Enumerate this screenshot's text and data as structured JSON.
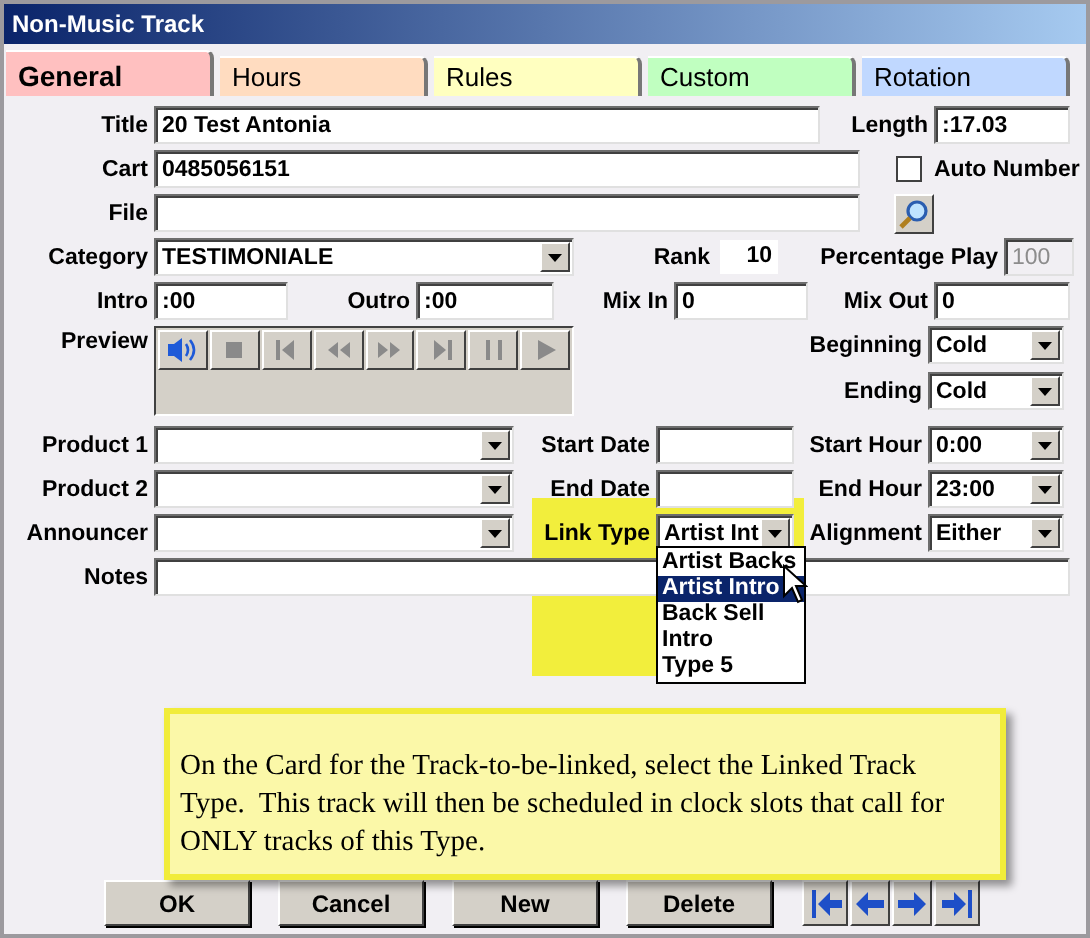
{
  "window": {
    "title": "Non-Music Track"
  },
  "tabs": [
    {
      "label": "General",
      "selected": true,
      "color": "#ffc0c0"
    },
    {
      "label": "Hours",
      "selected": false,
      "color": "#ffdcc0"
    },
    {
      "label": "Rules",
      "selected": false,
      "color": "#ffffc0"
    },
    {
      "label": "Custom",
      "selected": false,
      "color": "#c0ffc0"
    },
    {
      "label": "Rotation",
      "selected": false,
      "color": "#c0d8ff"
    }
  ],
  "title": {
    "label": "Title",
    "value": "20 Test Antonia"
  },
  "length": {
    "label": "Length",
    "value": ":17.03"
  },
  "cart": {
    "label": "Cart",
    "value": "0485056151"
  },
  "auto_number": {
    "label": "Auto Number",
    "checked": false
  },
  "file": {
    "label": "File"
  },
  "category": {
    "label": "Category",
    "value": "TESTIMONIALE"
  },
  "rank": {
    "label": "Rank",
    "value": "10"
  },
  "percentage_play": {
    "label": "Percentage Play",
    "value": "100",
    "disabled": true
  },
  "intro": {
    "label": "Intro",
    "value": ":00"
  },
  "outro": {
    "label": "Outro",
    "value": ":00"
  },
  "mix_in": {
    "label": "Mix In",
    "value": "0"
  },
  "mix_out": {
    "label": "Mix Out",
    "value": "0"
  },
  "preview": {
    "label": "Preview"
  },
  "beginning": {
    "label": "Beginning",
    "value": "Cold"
  },
  "ending": {
    "label": "Ending",
    "value": "Cold"
  },
  "product_1": {
    "label": "Product 1"
  },
  "start_date": {
    "label": "Start Date"
  },
  "start_hour": {
    "label": "Start Hour",
    "value": "0:00"
  },
  "product_2": {
    "label": "Product 2"
  },
  "end_date": {
    "label": "End Date"
  },
  "end_hour": {
    "label": "End Hour",
    "value": "23:00"
  },
  "announcer": {
    "label": "Announcer"
  },
  "link_type": {
    "label": "Link Type",
    "value": "Artist Int",
    "expanded": true,
    "options": [
      {
        "label": "Artist Backs",
        "selected": false
      },
      {
        "label": "Artist Intro",
        "selected": true
      },
      {
        "label": "Back Sell",
        "selected": false
      },
      {
        "label": "Intro",
        "selected": false
      },
      {
        "label": "Type 5",
        "selected": false
      }
    ]
  },
  "alignment": {
    "label": "Alignment",
    "value": "Either"
  },
  "notes": {
    "label": "Notes"
  },
  "callout": {
    "text": "On the Card for the Track-to-be-linked, select the Linked Track Type.  This track will then be scheduled in clock slots that call for ONLY tracks of this Type."
  },
  "buttons": [
    {
      "label": "OK"
    },
    {
      "label": "Cancel"
    },
    {
      "label": "New"
    },
    {
      "label": "Delete"
    }
  ]
}
